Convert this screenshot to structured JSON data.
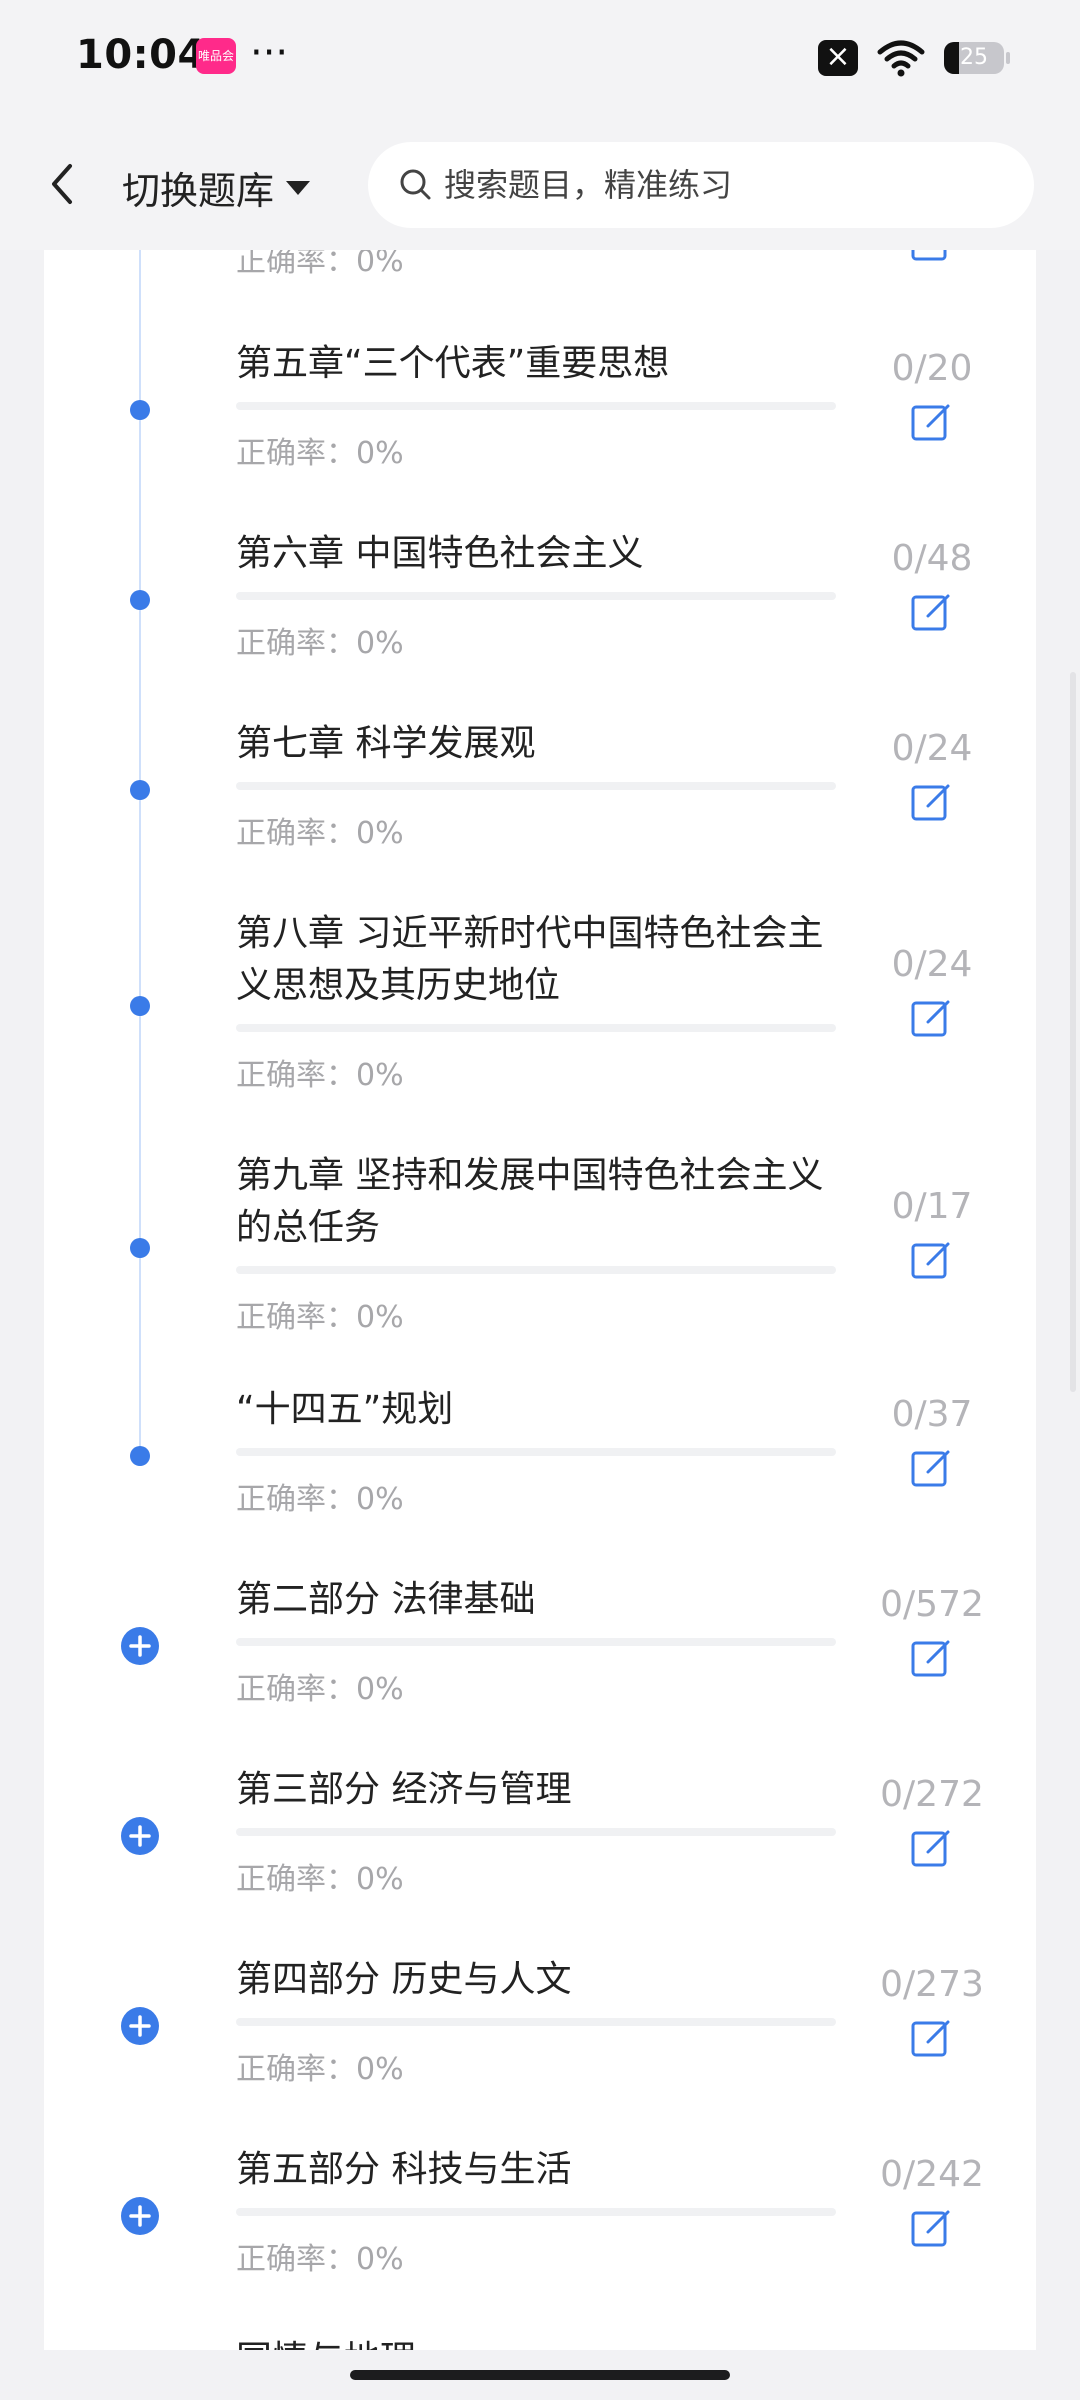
{
  "status_bar": {
    "time": "10:04",
    "app_badge": "唯品会",
    "dots": "···",
    "battery": "25",
    "battery_level": 0.25
  },
  "header": {
    "switch_label": "切换题库",
    "search_placeholder": "搜索题目，精准练习"
  },
  "accuracy_label": "正确率：0%",
  "partial_top": {
    "accuracy": "正确率：0%"
  },
  "chapters": [
    {
      "title": "第五章“三个代表”重要思想",
      "count": "0/20",
      "accuracy": "正确率：0%",
      "progress": 0
    },
    {
      "title": "第六章 中国特色社会主义",
      "count": "0/48",
      "accuracy": "正确率：0%",
      "progress": 0
    },
    {
      "title": "第七章 科学发展观",
      "count": "0/24",
      "accuracy": "正确率：0%",
      "progress": 0
    },
    {
      "title": "第八章 习近平新时代中国特色社会主义思想及其历史地位",
      "count": "0/24",
      "accuracy": "正确率：0%",
      "progress": 0
    },
    {
      "title": "第九章 坚持和发展中国特色社会主义的总任务",
      "count": "0/17",
      "accuracy": "正确率：0%",
      "progress": 0
    },
    {
      "title": "“十四五”规划",
      "count": "0/37",
      "accuracy": "正确率：0%",
      "progress": 0
    }
  ],
  "parts": [
    {
      "title": "第二部分 法律基础",
      "count": "0/572",
      "accuracy": "正确率：0%",
      "progress": 0
    },
    {
      "title": "第三部分 经济与管理",
      "count": "0/272",
      "accuracy": "正确率：0%",
      "progress": 0
    },
    {
      "title": "第四部分 历史与人文",
      "count": "0/273",
      "accuracy": "正确率：0%",
      "progress": 0
    },
    {
      "title": "第五部分 科技与生活",
      "count": "0/242",
      "accuracy": "正确率：0%",
      "progress": 0
    }
  ],
  "partial_bottom": {
    "title": "国情与地理"
  },
  "colors": {
    "accent": "#3a7be8",
    "muted_text": "#a7a7aa"
  }
}
